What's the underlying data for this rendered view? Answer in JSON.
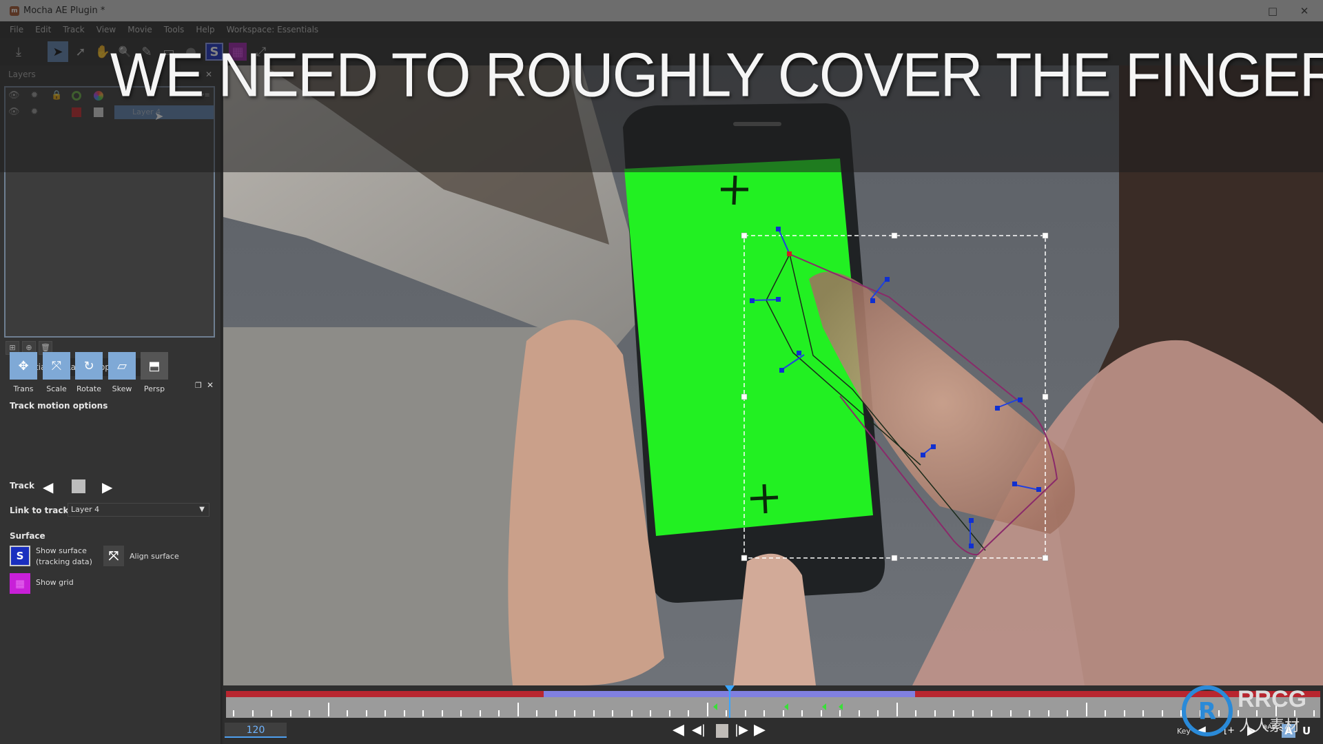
{
  "window": {
    "title": "Mocha AE Plugin *",
    "app_icon": "mocha-icon",
    "maximize_icon": "□",
    "close_icon": "✕"
  },
  "menu": [
    "File",
    "Edit",
    "Track",
    "View",
    "Movie",
    "Tools",
    "Help",
    "Workspace: Essentials"
  ],
  "toolbar": {
    "tools": [
      {
        "name": "export-icon",
        "glyph": "⤓"
      },
      {
        "name": "select-tool-icon",
        "glyph": "➤",
        "active": true
      },
      {
        "name": "add-point-tool-icon",
        "glyph": "➚"
      },
      {
        "name": "hand-tool-icon",
        "glyph": "✋"
      },
      {
        "name": "zoom-tool-icon",
        "glyph": "🔍"
      },
      {
        "name": "pen-tool-icon",
        "glyph": "✎"
      },
      {
        "name": "rectangle-tool-icon",
        "glyph": "▭"
      },
      {
        "name": "ellipse-tool-icon",
        "glyph": "●"
      },
      {
        "name": "show-surface-icon",
        "glyph": "S"
      },
      {
        "name": "show-grid-icon",
        "glyph": "▦"
      },
      {
        "name": "align-surface-icon",
        "glyph": "⤢"
      }
    ]
  },
  "layers_panel": {
    "label": "Layers",
    "header_icons": [
      "eye-icon",
      "gear-icon",
      "lock-icon",
      "color-wheel-icon",
      "color-palette-icon"
    ],
    "layers": [
      {
        "name": "Layer 4",
        "selected": true,
        "color": "#c0262c"
      }
    ],
    "bottom_buttons": [
      "new-folder-icon",
      "new-layer-icon",
      "delete-icon"
    ]
  },
  "properties_panel": {
    "tabs": [
      {
        "label": "Essentials",
        "active": true
      },
      {
        "label": "Layer Properties",
        "active": false
      }
    ],
    "track_motion_title": "Track motion options",
    "motion_options": [
      {
        "label": "Trans",
        "enabled": true,
        "glyph": "✥"
      },
      {
        "label": "Scale",
        "enabled": true,
        "glyph": "⤧"
      },
      {
        "label": "Rotate",
        "enabled": true,
        "glyph": "↻"
      },
      {
        "label": "Skew",
        "enabled": true,
        "glyph": "▱"
      },
      {
        "label": "Persp",
        "enabled": false,
        "glyph": "⬒"
      }
    ],
    "track_label": "Track",
    "link_to_track_label": "Link to track",
    "link_to_track_value": "Layer 4",
    "surface_title": "Surface",
    "show_surface_label_1": "Show surface",
    "show_surface_label_2": "(tracking data)",
    "align_surface_label": "Align surface",
    "show_grid_label": "Show grid"
  },
  "viewer": {
    "headline": "WE NEED TO ROUGHLY COVER THE FINGER",
    "colors": {
      "greenscreen": "#22f022",
      "spline_inner": "#2a3a2a",
      "spline_outer": "#8a2a6a",
      "control_point": "#1030d0",
      "selected_point": "#d02020"
    }
  },
  "timeline": {
    "current_frame": "120",
    "playhead_fraction": 0.46,
    "work_area_start_fraction": 0.29,
    "work_area_end_fraction": 0.63,
    "keyframe_fractions": [
      0.445,
      0.51,
      0.545,
      0.56
    ],
    "transport": [
      "◀",
      "◀|",
      "■",
      "|▶",
      "▶"
    ],
    "key_label": "Key",
    "key_buttons": [
      "◀",
      "[+",
      "▶",
      "⊗ALL",
      "A",
      "U"
    ]
  },
  "watermark": {
    "brand": "RRCG",
    "subtitle": "人人素材"
  }
}
